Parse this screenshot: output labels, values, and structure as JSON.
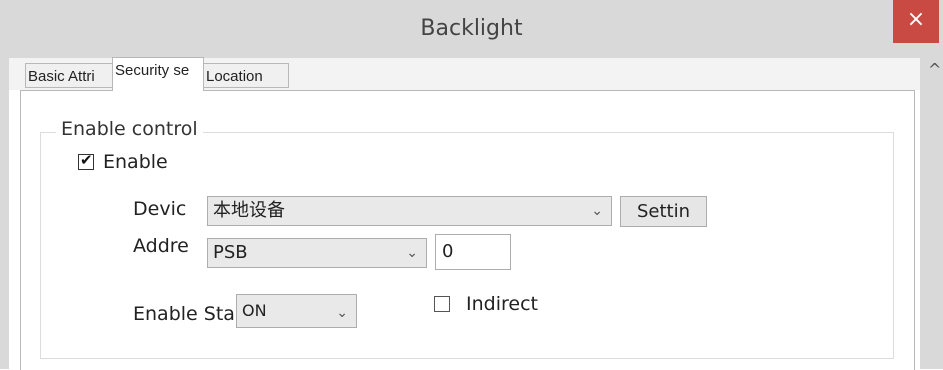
{
  "window": {
    "title": "Backlight",
    "close_glyph": "×",
    "scroll_glyph": "^"
  },
  "tabs": [
    {
      "label": "Basic Attri",
      "active": false
    },
    {
      "label": "Security se",
      "active": true
    },
    {
      "label": "Location",
      "active": false
    }
  ],
  "enable_control": {
    "group_title": "Enable control",
    "enable_checkbox": {
      "label": "Enable",
      "checked": true,
      "check_glyph": "✔"
    },
    "device": {
      "label": "Devic",
      "value": "本地设备",
      "button_label": "Settin"
    },
    "address": {
      "label": "Addre",
      "type_value": "PSB",
      "index_value": "0"
    },
    "enable_state": {
      "label": "Enable Sta",
      "value": "ON"
    },
    "indirect_checkbox": {
      "label": "Indirect",
      "checked": false
    }
  },
  "dropdown_arrow_glyph": "⌄"
}
